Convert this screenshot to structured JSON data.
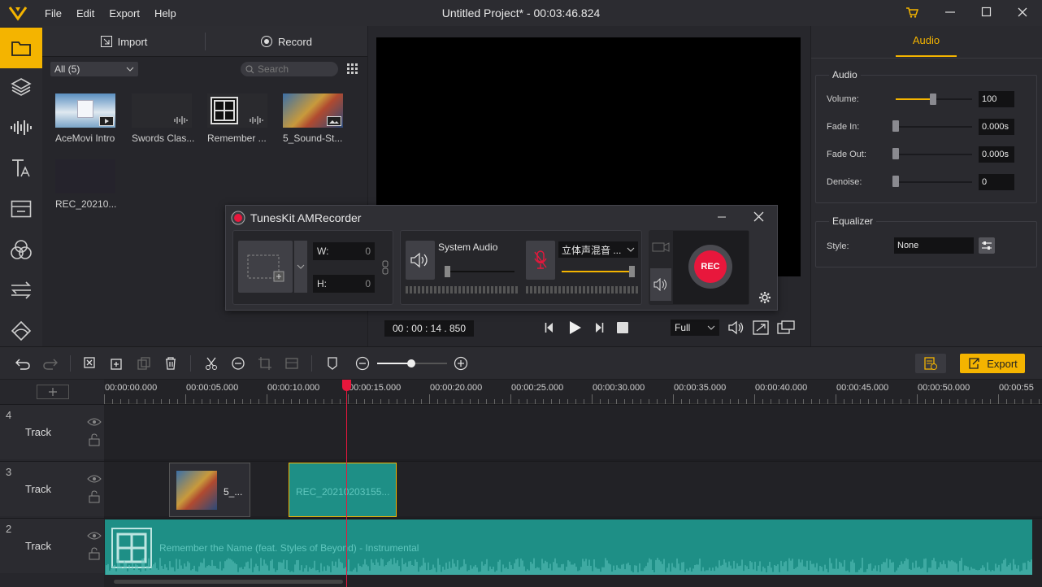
{
  "app": {
    "title": "Untitled Project* - 00:03:46.824",
    "menu": [
      "File",
      "Edit",
      "Export",
      "Help"
    ]
  },
  "media": {
    "import_label": "Import",
    "record_label": "Record",
    "filter_value": "All (5)",
    "search_placeholder": "Search",
    "items": [
      {
        "caption": "AceMovi Intro"
      },
      {
        "caption": "Swords Clas..."
      },
      {
        "caption": "Remember ..."
      },
      {
        "caption": "5_Sound-St..."
      },
      {
        "caption": "REC_20210..."
      }
    ]
  },
  "preview": {
    "time": "00 : 00 : 14 . 850",
    "zoom": "Full"
  },
  "props": {
    "tab": "Audio",
    "audio_group": "Audio",
    "volume_label": "Volume:",
    "volume_value": "100",
    "volume_level": 0.5,
    "fadein_label": "Fade In:",
    "fadein_value": "0.000s",
    "fadeout_label": "Fade Out:",
    "fadeout_value": "0.000s",
    "denoise_label": "Denoise:",
    "denoise_value": "0",
    "eq_group": "Equalizer",
    "style_label": "Style:",
    "style_value": "None"
  },
  "recorder": {
    "title": "TunesKit AMRecorder",
    "w_label": "W:",
    "w_value": "0",
    "h_label": "H:",
    "h_value": "0",
    "system_audio_label": "System Audio",
    "mic_device": "立体声混音 ...",
    "rec_label": "REC"
  },
  "toolbar": {
    "export_label": "Export"
  },
  "timeline": {
    "ruler": [
      "00:00:00.000",
      "00:00:05.000",
      "00:00:10.000",
      "00:00:15.000",
      "00:00:20.000",
      "00:00:25.000",
      "00:00:30.000",
      "00:00:35.000",
      "00:00:40.000",
      "00:00:45.000",
      "00:00:50.000",
      "00:00:55"
    ],
    "tracks": [
      {
        "num": "4",
        "name": "Track"
      },
      {
        "num": "3",
        "name": "Track"
      },
      {
        "num": "2",
        "name": "Track"
      }
    ],
    "clip_video_label": "5_...",
    "clip_rec_label": "REC_20210203155...",
    "clip_audio_label": "Remember the Name (feat. Styles of Beyond) - Instrumental"
  },
  "colors": {
    "accent": "#f4b400",
    "teal_clip": "#1e8f86",
    "rec_red": "#e8173c"
  }
}
